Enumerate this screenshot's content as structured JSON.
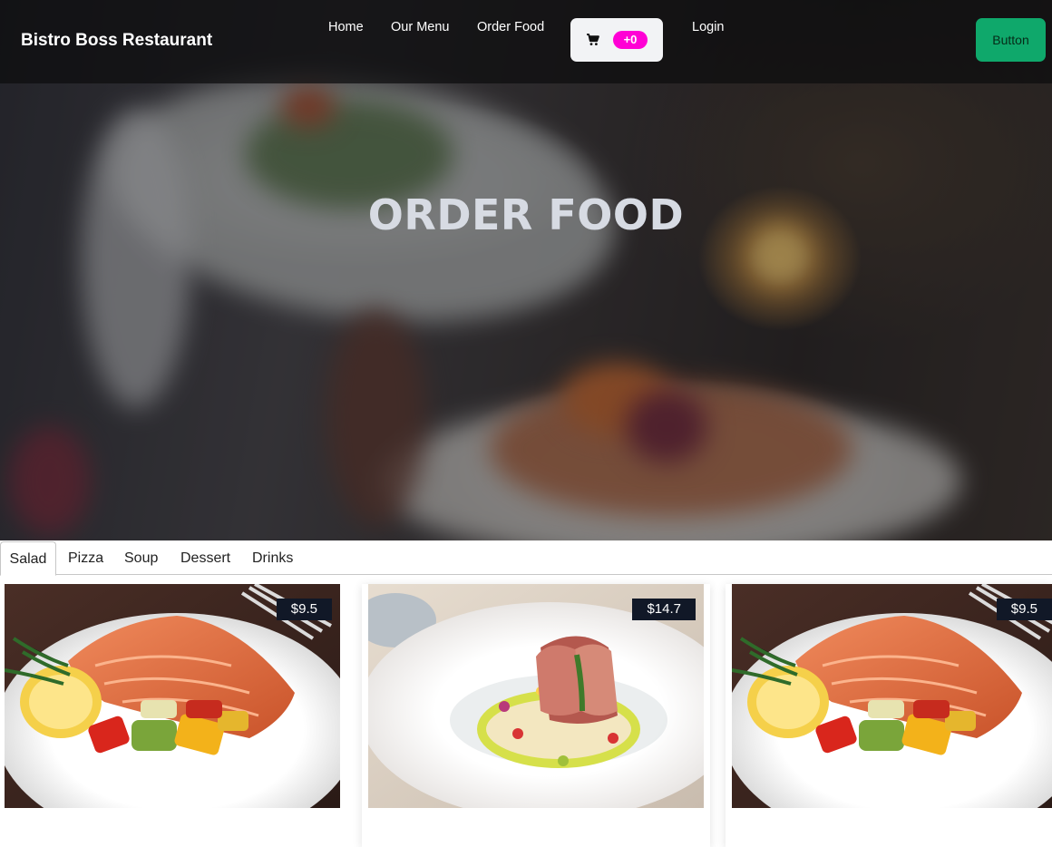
{
  "navbar": {
    "brand": "Bistro Boss Restaurant",
    "links": [
      "Home",
      "Our Menu",
      "Order Food",
      "Login"
    ],
    "cart_badge": "+0",
    "cart_icon": "cart-icon",
    "cta_label": "Button"
  },
  "hero": {
    "title": "ORDER FOOD"
  },
  "tabs": {
    "items": [
      "Salad",
      "Pizza",
      "Soup",
      "Dessert",
      "Drinks"
    ],
    "active": "Salad"
  },
  "cards": [
    {
      "price": "$9.5",
      "image": "salmon-plate"
    },
    {
      "price": "$14.7",
      "image": "meat-roll-plate"
    },
    {
      "price": "$9.5",
      "image": "salmon-plate"
    }
  ],
  "colors": {
    "badge": "#ff00d5",
    "cta": "#0fa86b",
    "price_tag": "#111827"
  }
}
